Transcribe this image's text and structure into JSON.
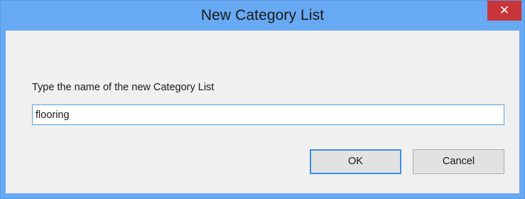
{
  "dialog": {
    "title": "New Category List",
    "close_label": "✕",
    "prompt": "Type the name of the new Category List",
    "name_value": "flooring",
    "ok_label": "OK",
    "cancel_label": "Cancel"
  },
  "colors": {
    "titlebar": "#68a9f3",
    "close_button": "#c7343a",
    "client_background": "#f0f0f0",
    "input_border": "#5aa0e0",
    "button_focus_border": "#3c8ee6"
  },
  "icons": {
    "close": "close-icon"
  }
}
